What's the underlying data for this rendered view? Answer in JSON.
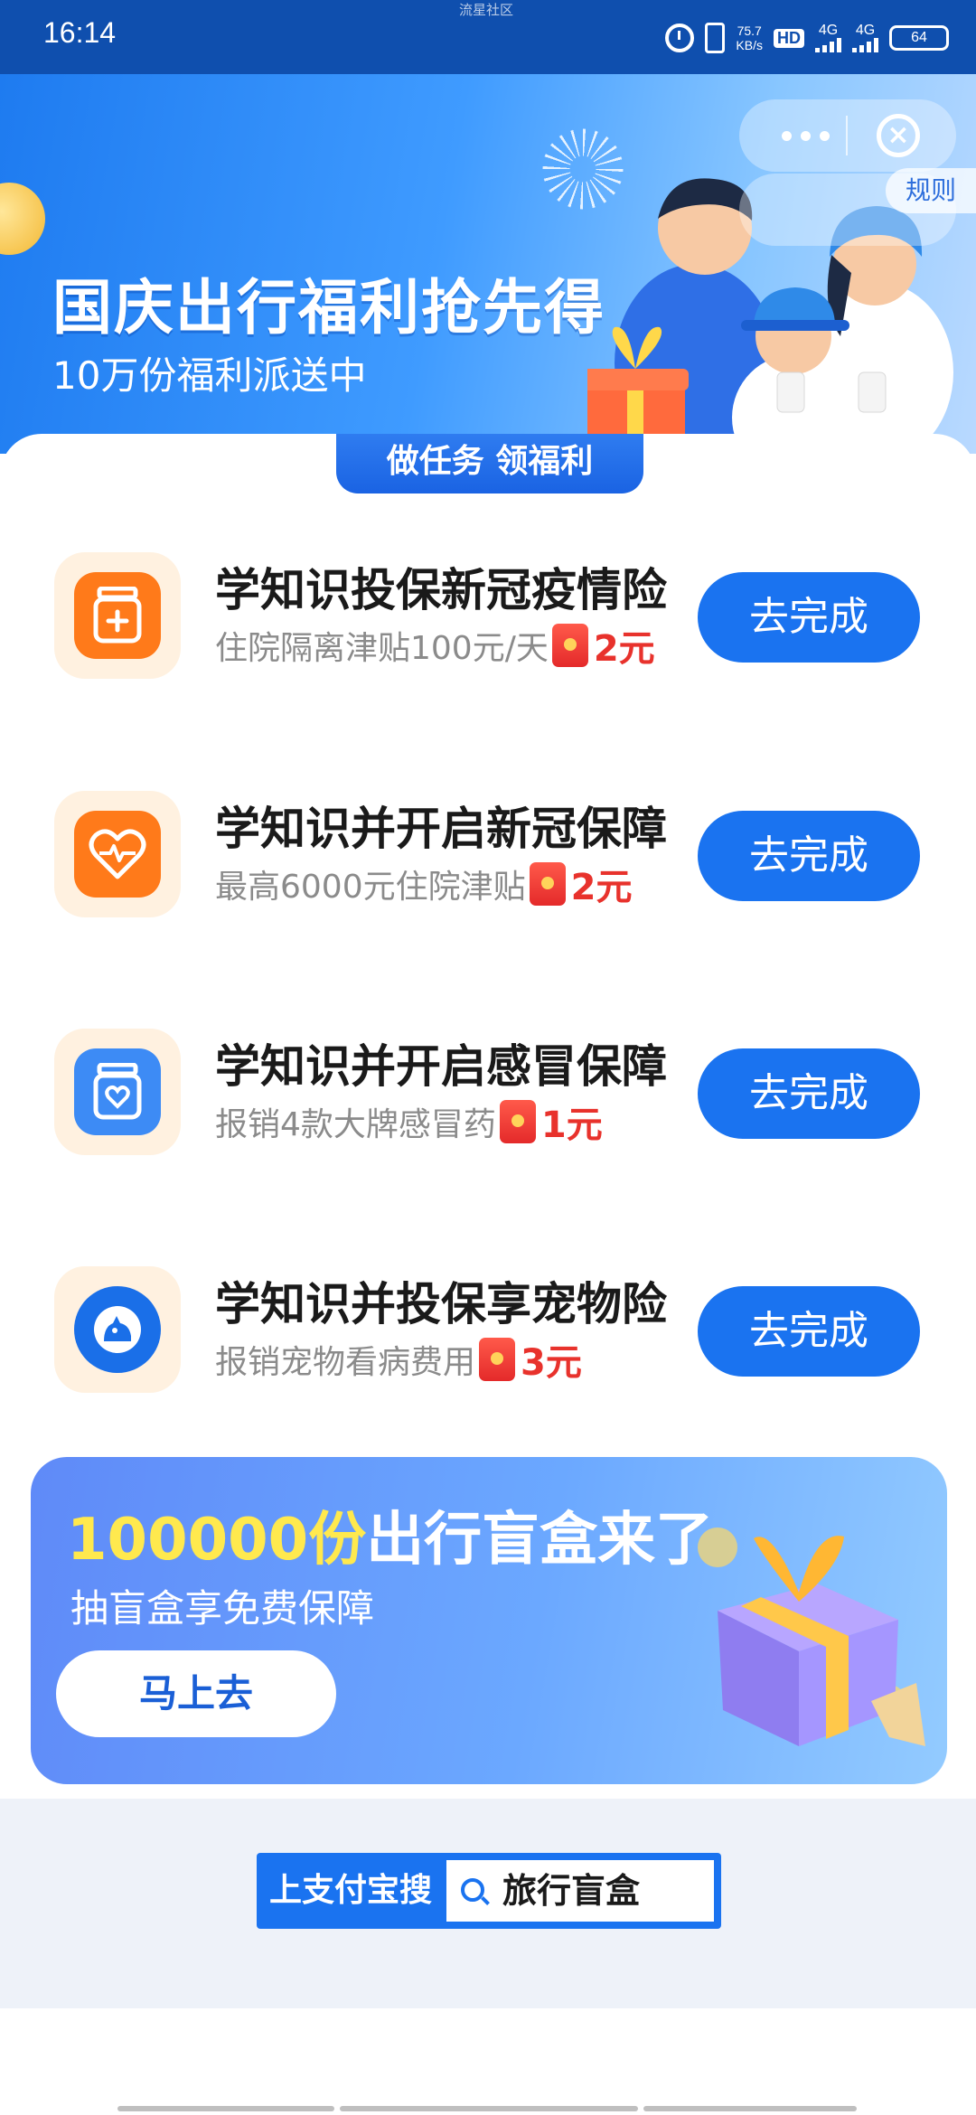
{
  "status_bar": {
    "time": "16:14",
    "watermark": "流星社区",
    "net_speed_value": "75.7",
    "net_speed_unit": "KB/s",
    "hd": "HD",
    "sim1": "4G",
    "sim2": "4G",
    "battery": "64"
  },
  "banner": {
    "title": "国庆出行福利抢先得",
    "subtitle": "10万份福利派送中",
    "rules": "规则"
  },
  "section": {
    "tab_label": "做任务 领福利"
  },
  "tasks": [
    {
      "title": "学知识投保新冠疫情险",
      "desc": "住院隔离津贴100元/天",
      "reward": "2元",
      "button": "去完成",
      "icon": "medicine-bottle-icon",
      "icon_color": "#ff7a1a"
    },
    {
      "title": "学知识并开启新冠保障",
      "desc": "最高6000元住院津贴",
      "reward": "2元",
      "button": "去完成",
      "icon": "heart-pulse-icon",
      "icon_color": "#ff7a1a"
    },
    {
      "title": "学知识并开启感冒保障",
      "desc": "报销4款大牌感冒药",
      "reward": "1元",
      "button": "去完成",
      "icon": "heart-bottle-icon",
      "icon_color": "#3d8bf5"
    },
    {
      "title": "学知识并投保享宠物险",
      "desc": "报销宠物看病费用",
      "reward": "3元",
      "button": "去完成",
      "icon": "pet-shield-icon",
      "icon_color": "#1a6fe8"
    }
  ],
  "blind_box": {
    "title_highlight": "100000份",
    "title_rest": "出行盲盒来了",
    "subtitle": "抽盲盒享免费保障",
    "button": "马上去"
  },
  "footer": {
    "search_label": "上支付宝搜",
    "search_term": "旅行盲盒"
  },
  "colors": {
    "primary": "#1a73f0",
    "reward_red": "#e8322c",
    "status_bar": "#0f4fae"
  }
}
